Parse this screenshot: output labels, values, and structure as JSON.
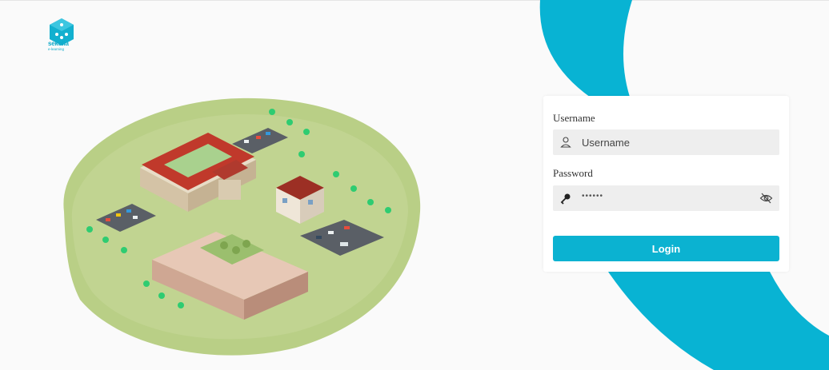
{
  "brand": {
    "name": "sekolia",
    "tagline": "e-learning",
    "accent": "#0bb2d1"
  },
  "login": {
    "username_label": "Username",
    "username_placeholder": "Username",
    "password_label": "Password",
    "password_mask": "••••••",
    "submit_label": "Login"
  },
  "icons": {
    "username": "user-icon",
    "password": "key-icon",
    "toggle_password": "eye-slash-icon"
  }
}
